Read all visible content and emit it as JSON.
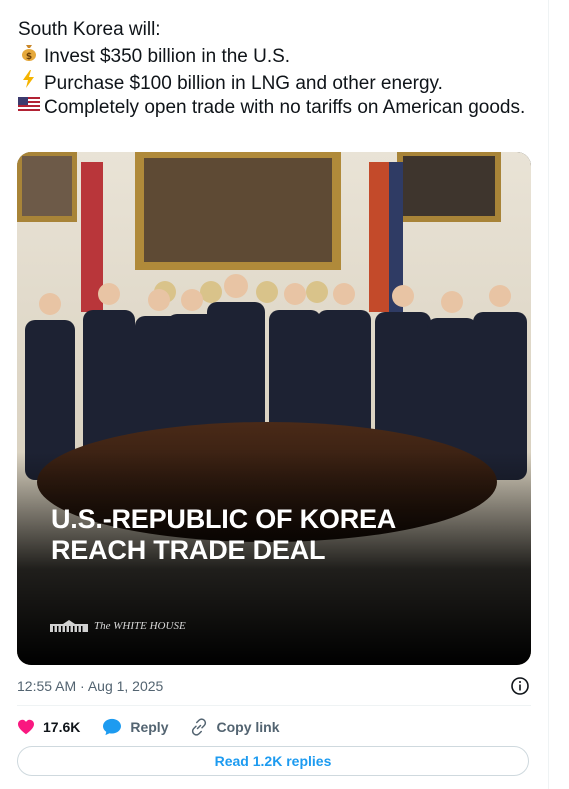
{
  "tweet": {
    "lines": [
      "South Korea will:",
      "Invest $350 billion in the U.S.",
      "Purchase $100 billion in LNG and other energy.",
      "Completely open trade with no tariffs on American goods."
    ],
    "line_icons": [
      "money-bag-icon",
      "lightning-icon",
      "us-flag-icon"
    ]
  },
  "media": {
    "headline_line1": "U.S.-REPUBLIC OF KOREA",
    "headline_line2": "REACH TRADE DEAL",
    "logo_text": "The WHITE HOUSE"
  },
  "meta": {
    "timestamp": "12:55 AM · Aug 1, 2025"
  },
  "actions": {
    "like_count": "17.6K",
    "reply_label": "Reply",
    "copy_label": "Copy link"
  },
  "read_replies_label": "Read 1.2K replies",
  "colors": {
    "like": "#f91880",
    "accent": "#1d9bf0",
    "muted": "#536471"
  }
}
